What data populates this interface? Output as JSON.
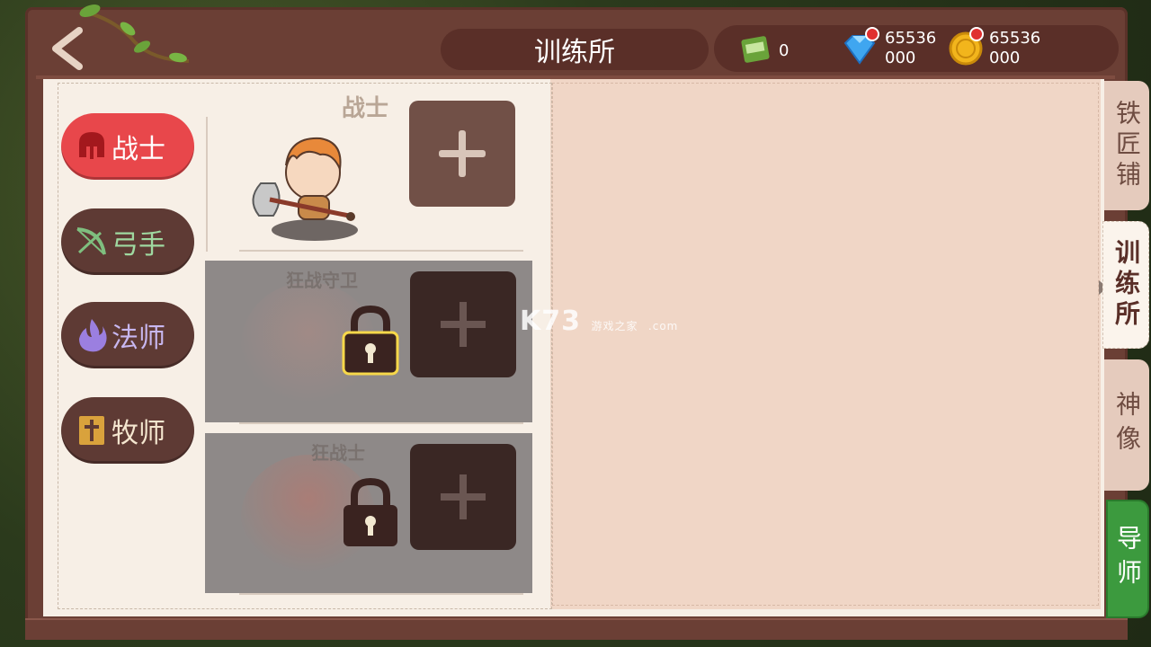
{
  "header": {
    "title": "训练所",
    "back_label": "back"
  },
  "resources": {
    "exp": "0",
    "diamond": "65536000",
    "gold": "65536000"
  },
  "classes": [
    {
      "label": "战士",
      "icon": "helmet-icon",
      "active": true
    },
    {
      "label": "弓手",
      "icon": "bow-icon",
      "active": false
    },
    {
      "label": "法师",
      "icon": "flame-icon",
      "active": false
    },
    {
      "label": "牧师",
      "icon": "holy-book-icon",
      "active": false
    }
  ],
  "main": {
    "section_title": "战士",
    "locked_titles": [
      "狂战守卫",
      "狂战士"
    ]
  },
  "side_tabs": [
    {
      "label": "铁匠铺"
    },
    {
      "label": "训练所"
    },
    {
      "label": "神像"
    },
    {
      "label": "导师"
    }
  ],
  "watermark": {
    "logo": "K73",
    "sub1": "游戏之家",
    "sub2": ".com"
  },
  "colors": {
    "frame": "#6b3f35",
    "active_class": "#e8474b",
    "active_tab": "#fbf4ec",
    "mentor_tab": "#3c9a3e"
  }
}
